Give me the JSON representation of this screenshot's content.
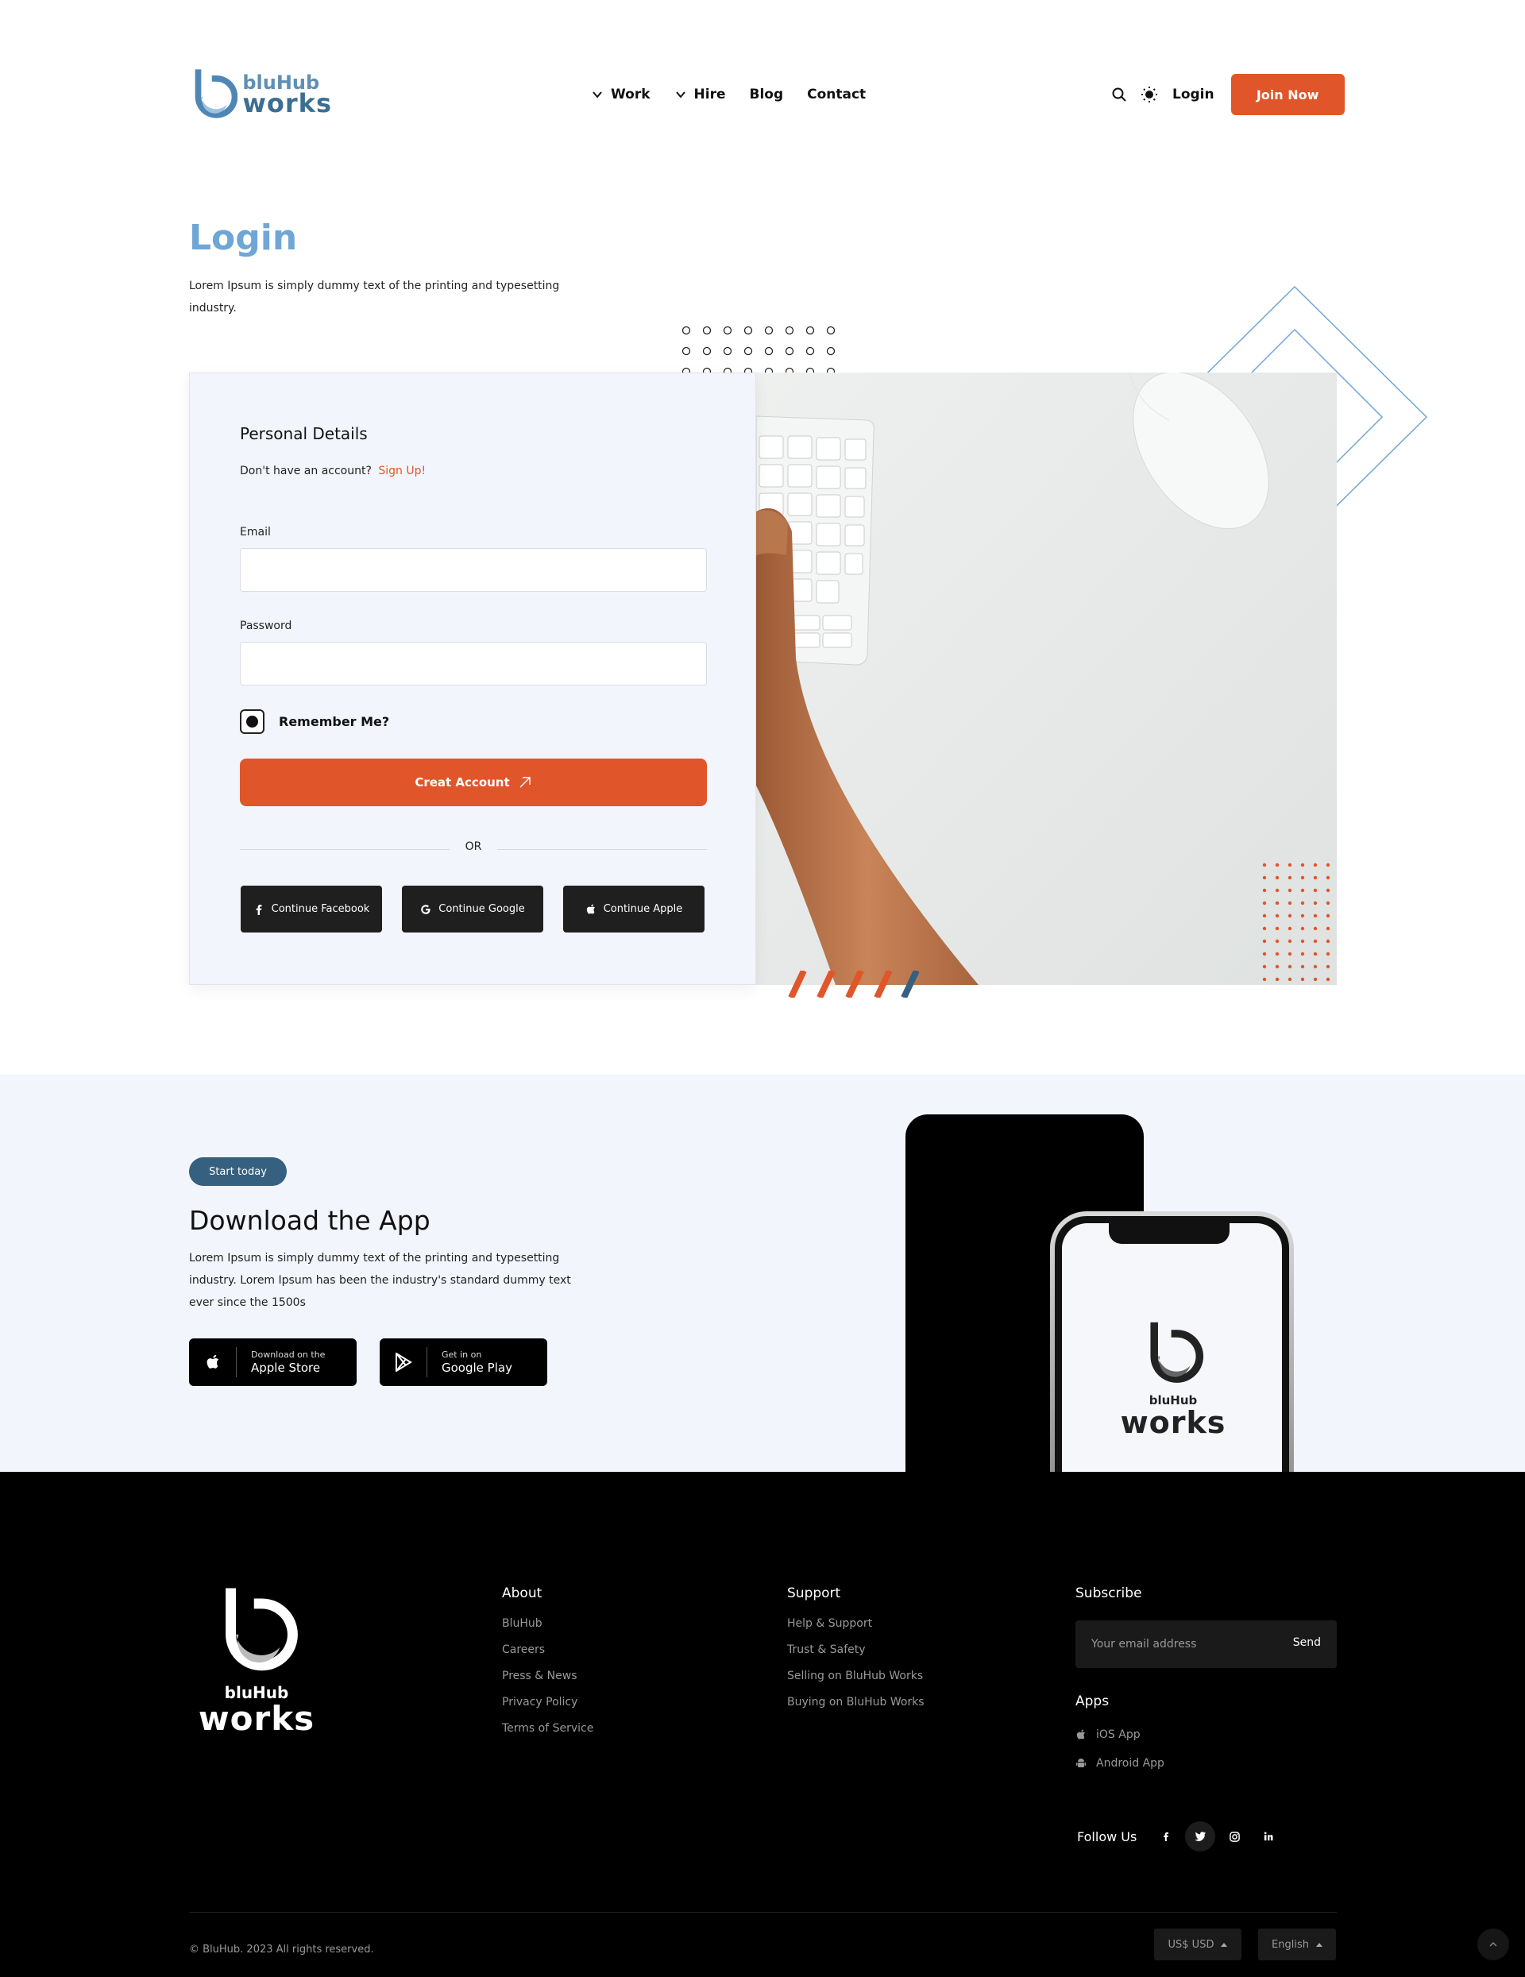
{
  "header": {
    "logo_line1": "bluHub",
    "logo_line2": "works",
    "nav": [
      {
        "label": "Work",
        "has_dropdown": true
      },
      {
        "label": "Hire",
        "has_dropdown": true
      },
      {
        "label": "Blog",
        "has_dropdown": false
      },
      {
        "label": "Contact",
        "has_dropdown": false
      }
    ],
    "search_icon": "search-icon",
    "theme_icon": "sun-icon",
    "login_label": "Login",
    "join_label": "Join Now"
  },
  "login": {
    "title": "Login",
    "description": "Lorem Ipsum is simply dummy text of the printing and typesetting industry."
  },
  "form": {
    "section_title": "Personal Details",
    "no_account_text": "Don't have an account?",
    "signup_link": "Sign Up!",
    "email_label": "Email",
    "email_value": "",
    "password_label": "Password",
    "password_value": "",
    "remember_label": "Remember Me?",
    "remember_checked": true,
    "submit_label": "Creat Account",
    "or_text": "OR",
    "social": [
      {
        "label": "Continue Facebook",
        "icon": "facebook-icon"
      },
      {
        "label": "Continue Google",
        "icon": "google-icon"
      },
      {
        "label": "Continue Apple",
        "icon": "apple-icon"
      }
    ]
  },
  "download": {
    "badge": "Start today",
    "title": "Download the App",
    "description": "Lorem Ipsum is simply dummy text of the printing and typesetting industry. Lorem Ipsum has been the industry's standard dummy text ever since the 1500s",
    "apple_small": "Download on the",
    "apple_big": "Apple Store",
    "google_small": "Get in on",
    "google_big": "Google Play",
    "phone_logo_line1": "bluHub",
    "phone_logo_line2": "works"
  },
  "footer": {
    "logo_line1": "bluHub",
    "logo_line2": "works",
    "about": {
      "heading": "About",
      "links": [
        "BluHub",
        "Careers",
        "Press & News",
        "Privacy Policy",
        "Terms of Service"
      ]
    },
    "support": {
      "heading": "Support",
      "links": [
        "Help & Support",
        "Trust & Safety",
        "Selling on BluHub Works",
        "Buying on BluHub Works"
      ]
    },
    "subscribe": {
      "heading": "Subscribe",
      "placeholder": "Your email address",
      "send_label": "Send"
    },
    "apps": {
      "heading": "Apps",
      "ios_label": "iOS App",
      "android_label": "Android App"
    },
    "follow_label": "Follow Us",
    "social_icons": [
      "facebook-icon",
      "twitter-icon",
      "instagram-icon",
      "linkedin-icon"
    ],
    "copyright": "© BluHub. 2023 All rights reserved.",
    "currency": "US$ USD",
    "language": "English"
  },
  "colors": {
    "accent": "#e0552a",
    "title_blue": "#6fa6d6",
    "badge_blue": "#36607f",
    "card_bg": "#f2f5fc",
    "footer_bg": "#000000"
  }
}
